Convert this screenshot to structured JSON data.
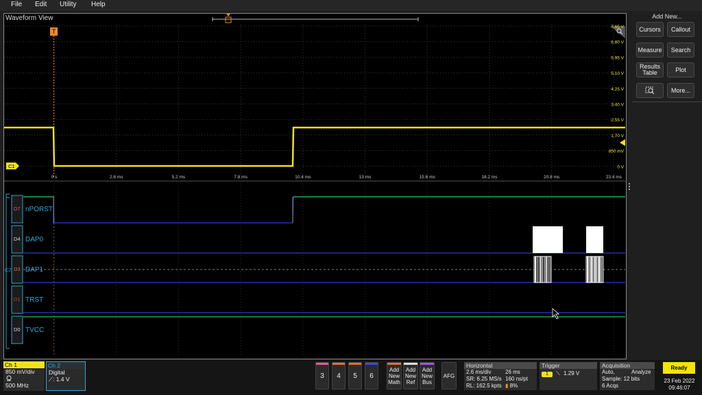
{
  "menu": [
    "File",
    "Edit",
    "Utility",
    "Help"
  ],
  "waveform_view": {
    "title": "Waveform View",
    "trigger_marker": "T",
    "channel_tag": "C1",
    "volt_labels": [
      "7.65 V",
      "6.80 V",
      "5.95 V",
      "5.10 V",
      "4.25 V",
      "3.40 V",
      "2.55 V",
      "1.70 V",
      "850 mV",
      "0 V"
    ],
    "time_labels": [
      "0 s",
      "2.6 ms",
      "5.2 ms",
      "7.8 ms",
      "10.4 ms",
      "13 ms",
      "15.6 ms",
      "18.2 ms",
      "20.8 ms",
      "23.4 ms"
    ],
    "digital_group_tag": "C2",
    "digital_channels": [
      {
        "tag": "D7",
        "name": "nPORST"
      },
      {
        "tag": "D4",
        "name": "DAP0"
      },
      {
        "tag": "D3",
        "name": "DAP1"
      },
      {
        "tag": "D1",
        "name": "TRST"
      },
      {
        "tag": "D0",
        "name": "TVCC"
      }
    ]
  },
  "side_panel": {
    "title": "Add New...",
    "buttons": [
      "Cursors",
      "Callout",
      "Measure",
      "Search",
      "Results Table",
      "Plot",
      "",
      "More..."
    ]
  },
  "bottom": {
    "ch1": {
      "label": "Ch 1",
      "scale": "850 mV/div",
      "bw": "500 MHz"
    },
    "ch2": {
      "label": "Ch 2",
      "type": "Digital",
      "threshold": "1.4 V"
    },
    "channel_buttons": [
      "3",
      "4",
      "5",
      "6"
    ],
    "add_buttons": [
      "Add New Math",
      "Add New Ref",
      "Add New Bus"
    ],
    "afg": "AFG",
    "horizontal": {
      "title": "Horizontal",
      "scale": "2.6 ms/div",
      "position": "26 ms",
      "sr": "SR: 6.25 MS/s",
      "pt": "160 ns/pt",
      "rl": "RL: 162.5 kpts",
      "pct": "8%"
    },
    "trigger": {
      "title": "Trigger",
      "source": "1",
      "level": "1.29 V"
    },
    "acquisition": {
      "title": "Acquisition",
      "mode": "Auto,",
      "analyze": "Analyze",
      "sample": "Sample: 12 bits",
      "acqs": "6 Acqs"
    },
    "status": "Ready",
    "date": "23 Feb 2022",
    "time": "09:46:07"
  },
  "colors": {
    "ch1": "#f2e21b",
    "ch2": "#2fa9d6",
    "digital_high": "#22c44a",
    "digital_low": "#2a3ad8",
    "trigger": "#f08a1c",
    "ready": "#f5e400"
  }
}
